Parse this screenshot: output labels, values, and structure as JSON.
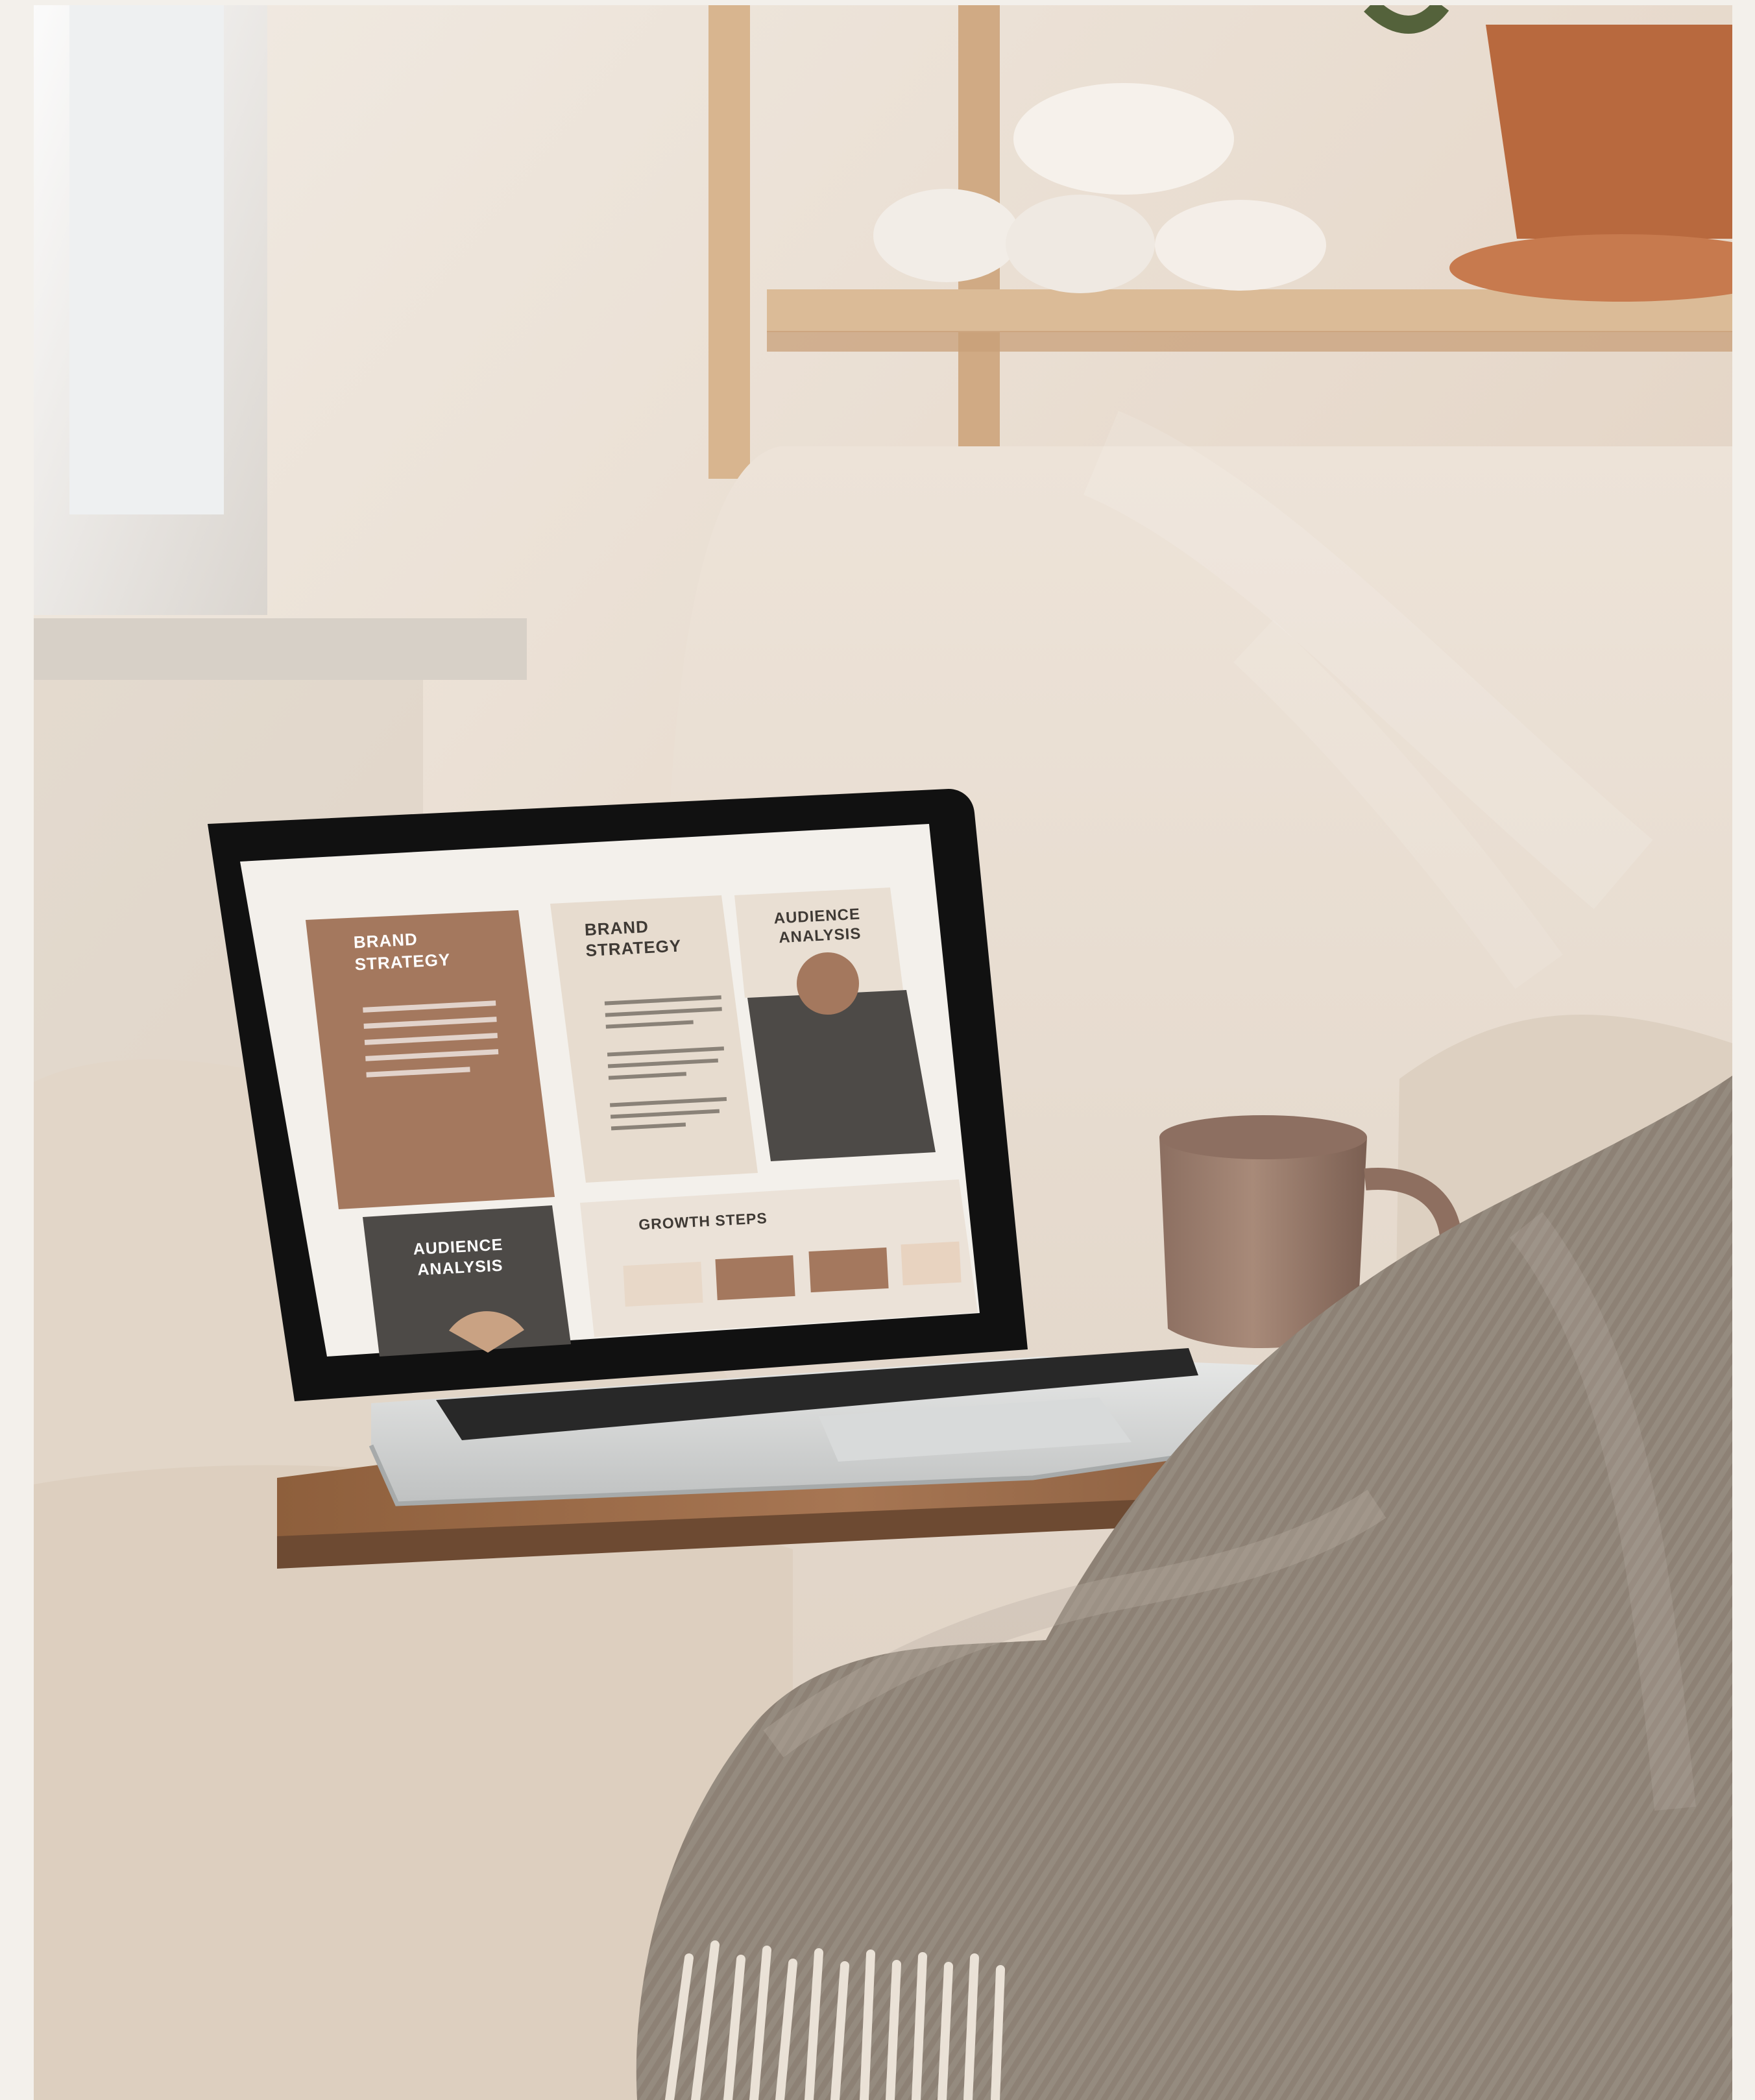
{
  "scene": {
    "subject": "laptop on armchair",
    "screen": {
      "card1_title_line1": "BRAND",
      "card1_title_line2": "STRATEGY",
      "card2_title_line1": "BRAND",
      "card2_title_line2": "STRATEGY",
      "card3_title_line1": "AUDIENCE",
      "card3_title_line2": "ANALYSIS",
      "card4_title_line1": "AUDIENCE",
      "card4_title_line2": "ANALYSIS",
      "card5_title": "GROWTH STEPS"
    }
  },
  "colors": {
    "background": "#f3f0eb",
    "wall": "#e8ded1",
    "chair": "#e6dccf",
    "laptop_screen_bg": "#f5f2ee",
    "tan_card": "#a4785e",
    "beige_card": "#e8ddd1",
    "charcoal_card": "#4d4a47",
    "wood_tray": "#9a6b47",
    "mug": "#9c7d6d",
    "throw": "#8e8378",
    "shelf": "#d7b58f",
    "terracotta": "#b66a41"
  },
  "icons": {
    "laptop": "laptop-icon",
    "mug": "mug-icon",
    "plant": "plant-icon",
    "throw_blanket": "blanket-icon"
  }
}
